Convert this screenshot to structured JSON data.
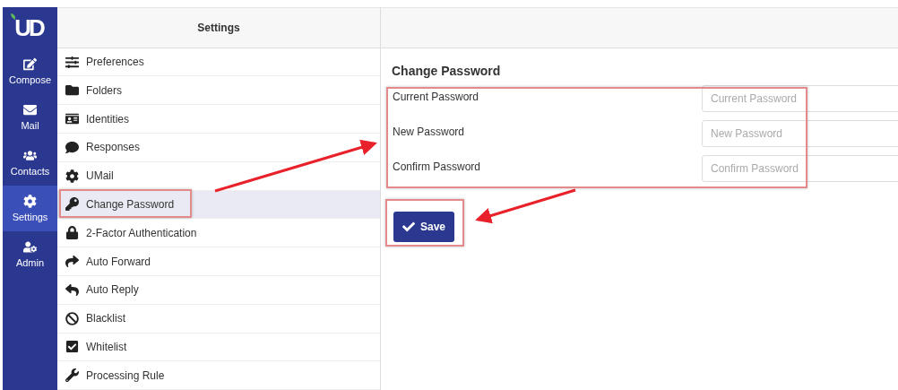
{
  "logo": {
    "text": "UD"
  },
  "nav": [
    {
      "label": "Compose",
      "selected": false
    },
    {
      "label": "Mail",
      "selected": false
    },
    {
      "label": "Contacts",
      "selected": false
    },
    {
      "label": "Settings",
      "selected": true
    },
    {
      "label": "Admin",
      "selected": false
    }
  ],
  "settings": {
    "title": "Settings",
    "items": [
      {
        "label": "Preferences",
        "selected": false
      },
      {
        "label": "Folders",
        "selected": false
      },
      {
        "label": "Identities",
        "selected": false
      },
      {
        "label": "Responses",
        "selected": false
      },
      {
        "label": "UMail",
        "selected": false
      },
      {
        "label": "Change Password",
        "selected": true
      },
      {
        "label": "2-Factor Authentication",
        "selected": false
      },
      {
        "label": "Auto Forward",
        "selected": false
      },
      {
        "label": "Auto Reply",
        "selected": false
      },
      {
        "label": "Blacklist",
        "selected": false
      },
      {
        "label": "Whitelist",
        "selected": false
      },
      {
        "label": "Processing Rule",
        "selected": false
      }
    ]
  },
  "form": {
    "title": "Change Password",
    "fields": [
      {
        "label": "Current Password",
        "placeholder": "Current Password"
      },
      {
        "label": "New Password",
        "placeholder": "New Password"
      },
      {
        "label": "Confirm Password",
        "placeholder": "Confirm Password"
      }
    ],
    "save_button": "Save"
  }
}
